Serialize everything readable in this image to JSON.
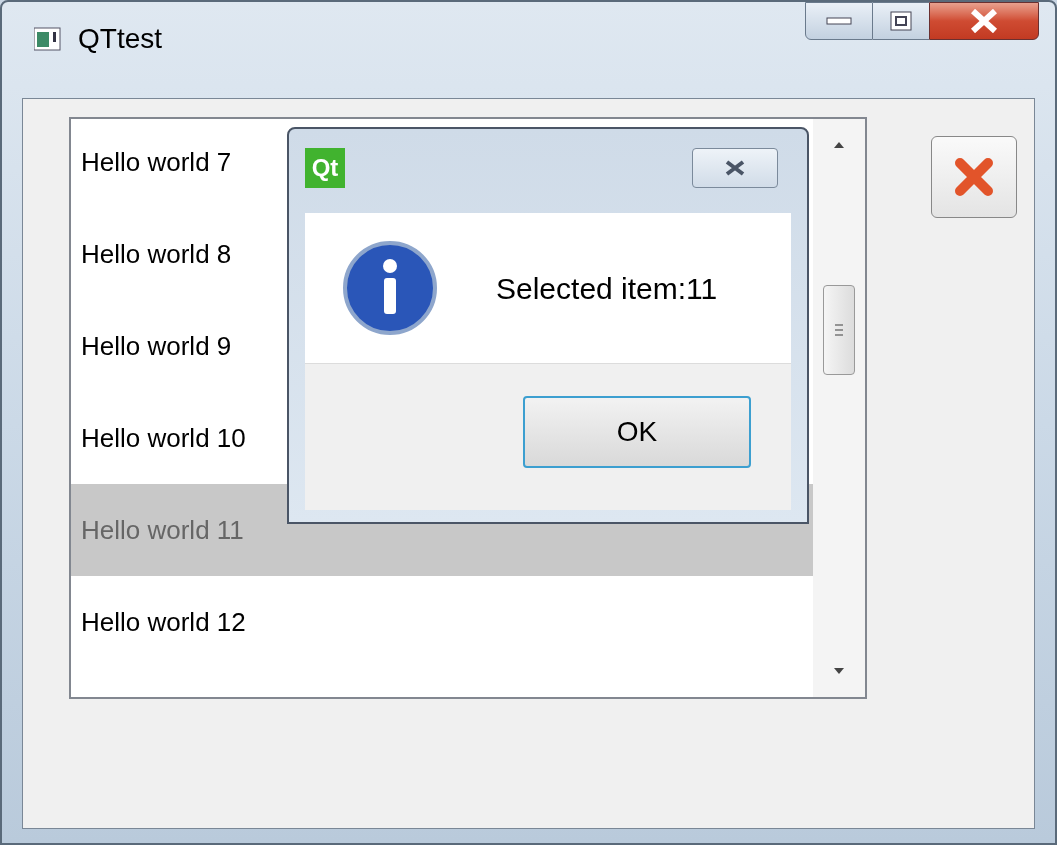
{
  "window": {
    "title": "QTtest"
  },
  "list": {
    "items": [
      {
        "label": "Hello world 7",
        "selected": false
      },
      {
        "label": "Hello world 8",
        "selected": false
      },
      {
        "label": "Hello world 9",
        "selected": false
      },
      {
        "label": "Hello world 10",
        "selected": false
      },
      {
        "label": "Hello world 11",
        "selected": true
      },
      {
        "label": "Hello world 12",
        "selected": false
      }
    ]
  },
  "dialog": {
    "logo_text": "Qt",
    "message": "Selected item:11",
    "buttons": [
      {
        "label": "OK",
        "default": true
      }
    ]
  }
}
